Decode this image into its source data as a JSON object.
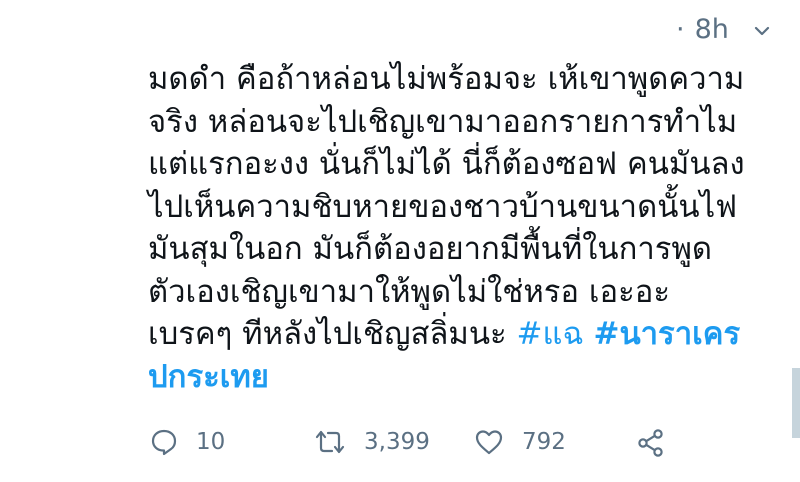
{
  "tweet": {
    "time_dot": "·",
    "time": "8h",
    "lines": [
      "มดดำ คือถ้าหล่อนไม่พร้อมจะ เห้เขาพูดความ",
      "จริง หล่อนจะไปเชิญเขามาออกรายการทำไม",
      "แต่แรกอะงง นั่นก็ไม่ได้ นี่ก็ต้องซอฟ คนมันลง",
      "ไปเห็นความชิบหายของชาวบ้านขนาดนั้นไฟ",
      "มันสุมในอก มันก็ต้องอยากมีพื้นที่ในการพูด",
      "ตัวเองเชิญเขามาให้พูดไม่ใช่หรอ เอะอะ",
      "เบรคๆ ทีหลังไปเชิญสลิ่มนะ "
    ],
    "hashtag_1": "#แฉ",
    "hashtag_2_part1": "#นาราเคร",
    "hashtag_2_part2": "ปกระเทย",
    "counts": {
      "replies": "10",
      "retweets": "3,399",
      "likes": "792"
    },
    "icons": {
      "more": "chevron-down-icon",
      "reply": "reply-icon",
      "retweet": "retweet-icon",
      "like": "heart-icon",
      "share": "share-icon"
    },
    "colors": {
      "text": "#0f1419",
      "secondary": "#5b7083",
      "link": "#1d9bf0"
    }
  }
}
